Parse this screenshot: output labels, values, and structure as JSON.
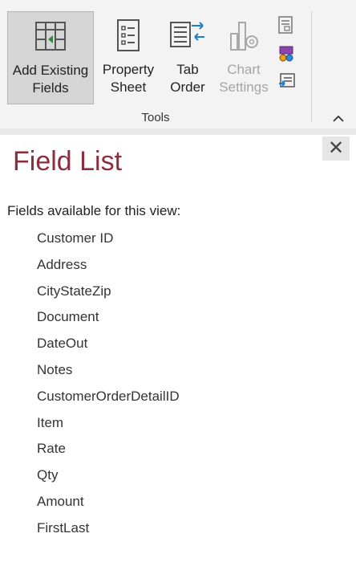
{
  "ribbon": {
    "buttons": [
      {
        "label1": "Add Existing",
        "label2": "Fields",
        "icon": "add-existing-fields-icon"
      },
      {
        "label1": "Property",
        "label2": "Sheet",
        "icon": "property-sheet-icon"
      },
      {
        "label1": "Tab",
        "label2": "Order",
        "icon": "tab-order-icon"
      },
      {
        "label1": "Chart",
        "label2": "Settings",
        "icon": "chart-settings-icon"
      }
    ],
    "small_icons": [
      "form-view-icon",
      "colored-boxes-icon",
      "convert-macros-icon"
    ],
    "group_label": "Tools",
    "accent": "#1e7bd0"
  },
  "pane": {
    "title": "Field List",
    "subtitle": "Fields available for this view:",
    "fields": [
      "Customer ID",
      "Address",
      "CityStateZip",
      "Document",
      "DateOut",
      "Notes",
      "CustomerOrderDetailID",
      "Item",
      "Rate",
      "Qty",
      "Amount",
      "FirstLast"
    ],
    "title_color": "#8b2f3f"
  }
}
